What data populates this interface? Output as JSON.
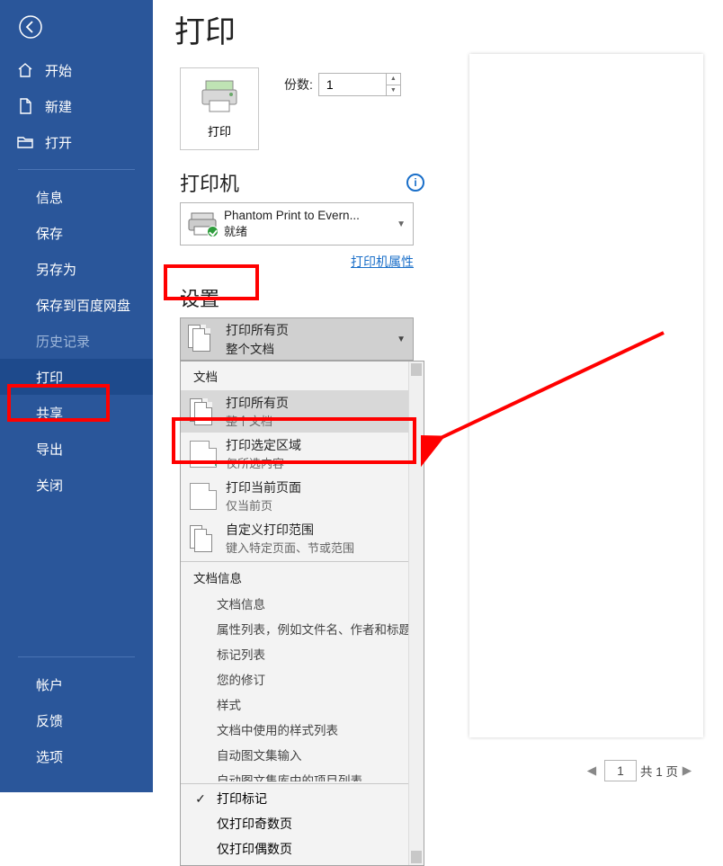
{
  "sidebar": {
    "items": [
      {
        "label": "开始"
      },
      {
        "label": "新建"
      },
      {
        "label": "打开"
      },
      {
        "label": "信息"
      },
      {
        "label": "保存"
      },
      {
        "label": "另存为"
      },
      {
        "label": "保存到百度网盘"
      },
      {
        "label": "历史记录"
      },
      {
        "label": "打印"
      },
      {
        "label": "共享"
      },
      {
        "label": "导出"
      },
      {
        "label": "关闭"
      },
      {
        "label": "帐户"
      },
      {
        "label": "反馈"
      },
      {
        "label": "选项"
      }
    ]
  },
  "page": {
    "title": "打印",
    "print_button": "打印",
    "copies_label": "份数:",
    "copies_value": "1"
  },
  "printer": {
    "section_title": "打印机",
    "name": "Phantom Print to Evern...",
    "status": "就绪",
    "properties_link": "打印机属性"
  },
  "settings": {
    "section_title": "设置",
    "selected": {
      "title": "打印所有页",
      "sub": "整个文档"
    },
    "group_doc": "文档",
    "options": [
      {
        "title": "打印所有页",
        "sub": "整个文档"
      },
      {
        "title": "打印选定区域",
        "sub": "仅所选内容"
      },
      {
        "title": "打印当前页面",
        "sub": "仅当前页"
      },
      {
        "title": "自定义打印范围",
        "sub": "键入特定页面、节或范围"
      }
    ],
    "group_info": "文档信息",
    "info_lines": [
      "文档信息",
      "属性列表，例如文件名、作者和标题",
      "标记列表",
      "您的修订",
      "样式",
      "文档中使用的样式列表",
      "自动图文集输入",
      "自动图文集库中的项目列表"
    ],
    "bottom": [
      {
        "label": "打印标记",
        "checked": true
      },
      {
        "label": "仅打印奇数页",
        "checked": false
      },
      {
        "label": "仅打印偶数页",
        "checked": false
      }
    ]
  },
  "nav": {
    "current": "1",
    "total_label": "共 1 页"
  }
}
